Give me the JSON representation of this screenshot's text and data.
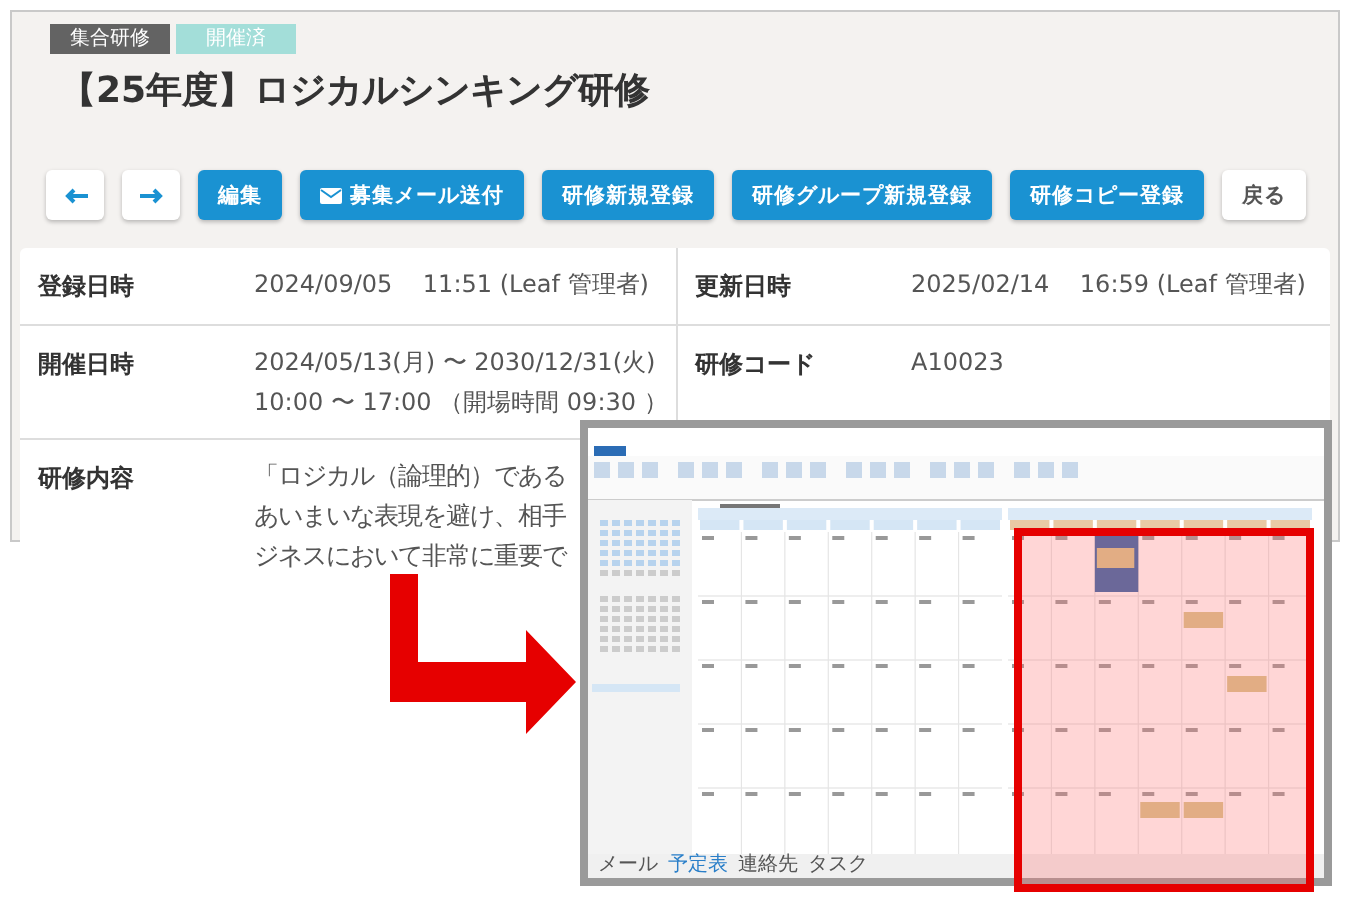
{
  "tags": [
    {
      "label": "集合研修",
      "kind": "category"
    },
    {
      "label": "開催済",
      "kind": "status"
    }
  ],
  "title": "【25年度】ロジカルシンキング研修",
  "toolbar": [
    {
      "kind": "prev"
    },
    {
      "kind": "next"
    },
    {
      "kind": "primary",
      "label": "編集"
    },
    {
      "kind": "mail",
      "label": "募集メール送付"
    },
    {
      "kind": "primary",
      "label": "研修新規登録"
    },
    {
      "kind": "primary",
      "label": "研修グループ新規登録"
    },
    {
      "kind": "primary",
      "label": "研修コピー登録"
    },
    {
      "kind": "secondary",
      "label": "戻る"
    }
  ],
  "details": [
    {
      "cells": [
        {
          "label": "登録日時",
          "lines": [
            "2024/09/05    11:51 (Leaf 管理者)"
          ]
        },
        {
          "label": "更新日時",
          "lines": [
            "2025/02/14    16:59 (Leaf 管理者)"
          ]
        }
      ]
    },
    {
      "cells": [
        {
          "label": "開催日時",
          "lines": [
            "2024/05/13(月) 〜 2030/12/31(火)",
            "10:00 〜 17:00 （開場時間 09:30 ）"
          ]
        },
        {
          "label": "研修コード",
          "lines": [
            "A10023"
          ]
        }
      ]
    },
    {
      "cells": [
        {
          "label": "研修内容",
          "lines": [
            "「ロジカル（論理的）である",
            "あいまいな表現を避け、相手",
            "ジネスにおいて非常に重要で"
          ]
        }
      ]
    }
  ],
  "screenshot": {
    "nav": [
      {
        "label": "メール",
        "selected": false
      },
      {
        "label": "予定表",
        "selected": true
      },
      {
        "label": "連絡先",
        "selected": false
      },
      {
        "label": "タスク",
        "selected": false
      }
    ]
  }
}
